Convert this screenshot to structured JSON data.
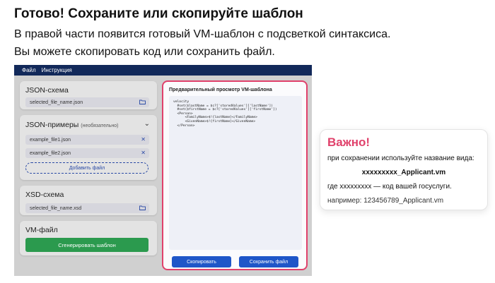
{
  "heading": "Готово! Сохраните или скопируйте шаблон",
  "description": [
    "В правой части появится готовый VM-шаблон с подсветкой синтаксиса.",
    "Вы можете скопировать код или сохранить файл."
  ],
  "app": {
    "menu": [
      "Файл",
      "Инструкция"
    ],
    "json_schema": {
      "title": "JSON-схема",
      "file": "selected_file_name.json",
      "icon": "folder-icon"
    },
    "json_examples": {
      "title": "JSON-примеры",
      "optional": "(необязательно)",
      "files": [
        "example_file1.json",
        "example_file2.json"
      ],
      "add_label": "Добавить файл"
    },
    "xsd_schema": {
      "title": "XSD-схема",
      "file": "selected_file_name.xsd"
    },
    "vm_file": {
      "title": "VM-файл",
      "generate_label": "Сгенерировать шаблон"
    },
    "preview": {
      "title": "Предварительный просмотр VM-шаблона",
      "code_lines": [
        "velocity",
        "  #set($lastName = $c?['storedValues']['lastName'])",
        "  #set($firstName = $c?['storedValues']['firstName'])",
        "  <Person>",
        "      <FamilyName>$!{lastName}</FamilyName>",
        "      <GivenName>$!{firstName}</GivenName>",
        "  </Person>"
      ],
      "copy_label": "Скопировать",
      "save_label": "Сохранить файл"
    },
    "colors": {
      "menubar": "#12295a",
      "accent_blue": "#1f56c8",
      "generate_green": "#2b9a4e",
      "highlight_pink": "#e0416b"
    }
  },
  "callout": {
    "title": "Важно!",
    "line1": "при сохранении используйте название вида:",
    "filename": "xxxxxxxxx_Applicant.vm",
    "line3": "где xxxxxxxxx — код вашей госуслуги.",
    "example": "например: 123456789_Applicant.vm"
  }
}
